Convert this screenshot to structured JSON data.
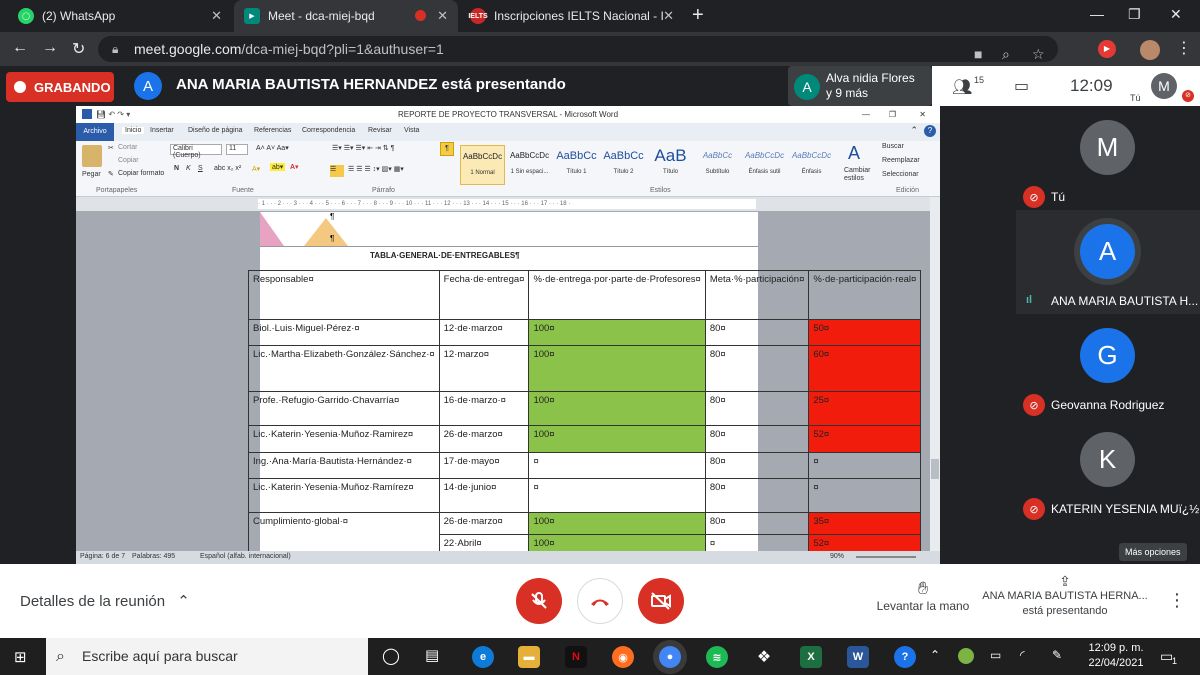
{
  "browser": {
    "tabs": [
      {
        "title": "(2) WhatsApp",
        "icon": "whatsapp-icon",
        "color": "#25d366"
      },
      {
        "title": "Meet - dca-miej-bqd",
        "icon": "meet-icon",
        "color": "#00897b"
      },
      {
        "title": "Inscripciones IELTS Nacional - IEL",
        "icon": "ielts-icon",
        "color": "#c62828"
      }
    ],
    "url_host": "meet.google.com",
    "url_path": "/dca-miej-bqd?pli=1&authuser=1"
  },
  "meet": {
    "recording_label": "GRABANDO",
    "presenter_initial": "A",
    "presenter_text": "ANA MARIA BAUTISTA HERNANDEZ está presentando",
    "other_initial": "A",
    "other_line1": "Alva nidia Flores",
    "other_line2": "y 9 más",
    "participant_count": "15",
    "time": "12:09",
    "self_initial": "M",
    "self_label": "Tú",
    "participants": [
      {
        "initial": "M",
        "name": "Tú",
        "color": "#5f6368",
        "state": "muted"
      },
      {
        "initial": "A",
        "name": "ANA MARIA BAUTISTA H...",
        "color": "#1a73e8",
        "state": "speaking"
      },
      {
        "initial": "G",
        "name": "Geovanna Rodriguez",
        "color": "#1a73e8",
        "state": "muted"
      },
      {
        "initial": "K",
        "name": "KATERIN YESENIA MUï¿½...",
        "color": "#5f6368",
        "state": "muted"
      }
    ],
    "more_options_tooltip": "Más opciones",
    "details_label": "Detalles de la reunión",
    "raise_hand_label": "Levantar la mano",
    "presenting_name": "ANA MARIA BAUTISTA HERNA...",
    "presenting_status": "está presentando"
  },
  "word": {
    "window_title": "REPORTE DE PROYECTO TRANSVERSAL - Microsoft Word",
    "file_tab": "Archivo",
    "tabs": [
      "Inicio",
      "Insertar",
      "Diseño de página",
      "Referencias",
      "Correspondencia",
      "Revisar",
      "Vista"
    ],
    "clipboard": {
      "paste": "Pegar",
      "cut": "Cortar",
      "copy": "Copiar",
      "format": "Copiar formato"
    },
    "font_name": "Calibri (Cuerpo)",
    "font_size": "11",
    "styles": [
      {
        "preview": "AaBbCcDc",
        "label": "1 Normal"
      },
      {
        "preview": "AaBbCcDc",
        "label": "1 Sin espaci..."
      },
      {
        "preview": "AaBbCc",
        "label": "Título 1"
      },
      {
        "preview": "AaBbCc",
        "label": "Título 2"
      },
      {
        "preview": "AaB",
        "label": "Título"
      },
      {
        "preview": "AaBbCc",
        "label": "Subtítulo"
      },
      {
        "preview": "AaBbCcDc",
        "label": "Énfasis sutil"
      },
      {
        "preview": "AaBbCcDc",
        "label": "Énfasis"
      }
    ],
    "change_styles": "Cambiar estilos",
    "edit": {
      "find": "Buscar",
      "replace": "Reemplazar",
      "select": "Seleccionar"
    },
    "groups": [
      "Portapapeles",
      "Fuente",
      "Párrafo",
      "Estilos",
      "Edición"
    ],
    "status": {
      "page": "Página: 6 de 7",
      "words": "Palabras: 495",
      "lang": "Español (alfab. internacional)",
      "zoom": "90%"
    },
    "table_title": "TABLA·GENERAL·DE·ENTREGABLES¶",
    "table_headers": [
      "Responsable¤",
      "Fecha·de·entrega¤",
      "%·de·entrega·por·parte·de·Profesores¤",
      "Meta·%·participación¤",
      "%·de·participación·real¤"
    ],
    "table_rows": [
      {
        "name": "Biol.·Luis·Miguel·Pérez·¤",
        "date": "12·de·marzo¤",
        "pct": "100¤",
        "meta": "80¤",
        "real": "50¤",
        "pct_color": "green",
        "real_color": "red"
      },
      {
        "name": "Lic.·Martha·Elizabeth·González·Sánchez·¤",
        "date": "12·marzo¤",
        "pct": "100¤",
        "meta": "80¤",
        "real": "60¤",
        "pct_color": "green",
        "real_color": "red"
      },
      {
        "name": "Profe.·Refugio·Garrido·Chavarría¤",
        "date": "16·de·marzo·¤",
        "pct": "100¤",
        "meta": "80¤",
        "real": "25¤",
        "pct_color": "green",
        "real_color": "red"
      },
      {
        "name": "Lic.·Katerin·Yesenia·Muñoz·Ramirez¤",
        "date": "26·de·marzo¤",
        "pct": "100¤",
        "meta": "80¤",
        "real": "52¤",
        "pct_color": "green",
        "real_color": "red"
      },
      {
        "name": "Ing.·Ana·María·Bautista·Hernández·¤",
        "date": "17·de·mayo¤",
        "pct": "¤",
        "meta": "80¤",
        "real": "¤",
        "pct_color": "none",
        "real_color": "none"
      },
      {
        "name": "Lic.·Katerin·Yesenia·Muñoz·Ramírez¤",
        "date": "14·de·junio¤",
        "pct": "¤",
        "meta": "80¤",
        "real": "¤",
        "pct_color": "none",
        "real_color": "none"
      }
    ],
    "global_row": {
      "name": "Cumplimiento·global·¤",
      "rows": [
        {
          "date": "26·de·marzo¤",
          "pct": "100¤",
          "meta": "80¤",
          "real": "35¤"
        },
        {
          "date": "22·Abril¤",
          "pct": "100¤",
          "meta": "¤",
          "real": "52¤"
        }
      ]
    },
    "para_marks": [
      "¶",
      "¶"
    ]
  },
  "taskbar": {
    "search_placeholder": "Escribe aquí para buscar",
    "time": "12:09 p. m.",
    "date": "22/04/2021",
    "notifications": "1"
  },
  "colors": {
    "green": "#8bc34a",
    "red": "#f21c0c",
    "meet_red": "#d93025",
    "meet_blue": "#1a73e8"
  }
}
